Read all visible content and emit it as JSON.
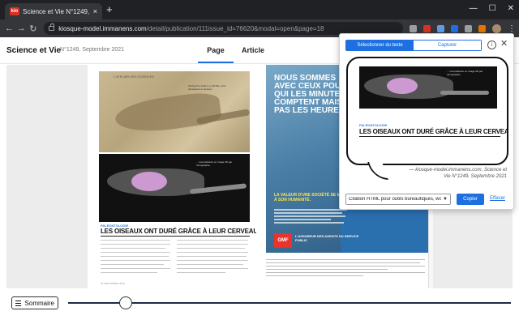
{
  "browser": {
    "tab_title": "Science et Vie N°1249, Septembre 2021",
    "favicon_text": "kio",
    "new_tab": "+",
    "tab_close": "×",
    "window_controls": [
      "—",
      "☐",
      "✕"
    ],
    "url_domain": "kiosque-model.immanens.com",
    "url_path": "/detail/publication/111issue_id=76620&modal=open&page=18",
    "back": "←",
    "forward": "→",
    "reload": "↻",
    "menu": "⋮",
    "extension_colors": [
      "#9aa0a6",
      "#d93025",
      "#5f9bea",
      "#1e70e0",
      "#9aa0a6",
      "#e37400"
    ]
  },
  "header": {
    "magazine_title": "Science et Vie",
    "issue": "N°1249, Septembre 2021",
    "tabs": [
      {
        "label": "Page",
        "active": true
      },
      {
        "label": "Article",
        "active": false
      }
    ]
  },
  "spread": {
    "left_page": {
      "kicker": "L'ATELIER DES SCIENCES",
      "headline": "LES OISEAUX ONT DURÉ GRÂCE À LEUR CERVEAU !",
      "fossil_caption": "Ichthyornis vivait il y a 90 Ma, entre dinosaures et oiseaux.",
      "scan_caption": "... reconstitution en image 3D par tomographie.",
      "footer": "52  SEPTEMBRE 2021"
    },
    "right_page": {
      "ad_headline": "NOUS SOMMES AVEC CEUX POUR QUI LES MINUTES COMPTENT MAIS PAS LES HEURES.",
      "ad_sub": "LA VALEUR D'UNE SOCIÉTÉ SE MESURE À SON HUMANITÉ.",
      "gmf_logo": "GMF",
      "gmf_tagline": "L'ASSUREUR DES AGENTS DU SERVICE PUBLIC"
    }
  },
  "popup": {
    "select_text": "Sélectionner du texte",
    "capture": "Capturer",
    "info": "i",
    "close": "✕",
    "clip": {
      "kicker": "PALÉONTOLOGIE",
      "headline": "LES OISEAUX ONT DURÉ GRÂCE À LEUR CERVEAU !",
      "caption": "... reconstitution en image 3D par tomographie."
    },
    "attribution": "— kiosque-model.immanens.com, Science et Vie N°1249, Septembre 2021",
    "format_value": "Citation HTML pour outils bureautiques, word",
    "copy": "Copier",
    "clear": "Effacer"
  },
  "bottom": {
    "summary": "Sommaire",
    "slider_progress": 0.13
  }
}
